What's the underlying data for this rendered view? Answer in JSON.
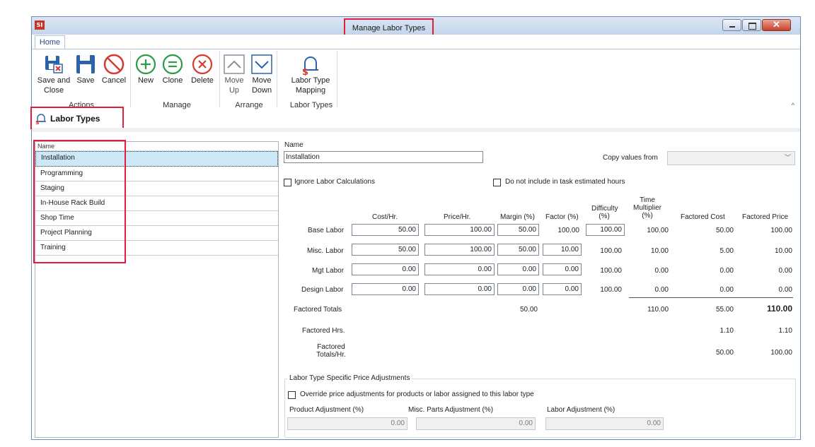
{
  "window": {
    "title": "Manage Labor Types",
    "app_icon": "SI"
  },
  "tabs": [
    {
      "label": "Home"
    }
  ],
  "ribbon": {
    "save_close": "Save and Close",
    "save_close_l1": "Save and",
    "save_close_l2": "Close",
    "save": "Save",
    "cancel": "Cancel",
    "new": "New",
    "clone": "Clone",
    "delete": "Delete",
    "move_up_l1": "Move",
    "move_up_l2": "Up",
    "move_down_l1": "Move",
    "move_down_l2": "Down",
    "mapping_l1": "Labor Type",
    "mapping_l2": "Mapping",
    "groups": {
      "actions": "Actions",
      "manage": "Manage",
      "arrange": "Arrange",
      "labor_types": "Labor Types"
    }
  },
  "header": {
    "title": "Labor Types"
  },
  "list": {
    "column": "Name",
    "items": [
      "Installation",
      "Programming",
      "Staging",
      "In-House Rack Build",
      "Shop Time",
      "Project Planning",
      "Training"
    ],
    "selected": "Installation"
  },
  "form": {
    "name_label": "Name",
    "name_value": "Installation",
    "copy_from_label": "Copy values from",
    "copy_from_value": "",
    "ignore_label": "Ignore Labor Calculations",
    "exclude_label": "Do not include in task estimated hours",
    "columns": {
      "cost": "Cost/Hr.",
      "price": "Price/Hr.",
      "margin": "Margin (%)",
      "factor": "Factor (%)",
      "difficulty_l1": "Difficulty",
      "difficulty_l2": "(%)",
      "time_l1": "Time",
      "time_l2": "Multiplier",
      "time_l3": "(%)",
      "factored_cost": "Factored Cost",
      "factored_price": "Factored Price"
    },
    "rows": [
      {
        "label": "Base Labor",
        "cost": "50.00",
        "price": "100.00",
        "margin": "50.00",
        "factor": "100.00",
        "difficulty": "100.00",
        "time": "100.00",
        "fcost": "50.00",
        "fprice": "100.00"
      },
      {
        "label": "Misc. Labor",
        "cost": "50.00",
        "price": "100.00",
        "margin": "50.00",
        "factor": "10.00",
        "difficulty": "100.00",
        "time": "10.00",
        "fcost": "5.00",
        "fprice": "10.00"
      },
      {
        "label": "Mgt Labor",
        "cost": "0.00",
        "price": "0.00",
        "margin": "0.00",
        "factor": "0.00",
        "difficulty": "100.00",
        "time": "0.00",
        "fcost": "0.00",
        "fprice": "0.00"
      },
      {
        "label": "Design Labor",
        "cost": "0.00",
        "price": "0.00",
        "margin": "0.00",
        "factor": "0.00",
        "difficulty": "100.00",
        "time": "0.00",
        "fcost": "0.00",
        "fprice": "0.00"
      }
    ],
    "totals": {
      "label": "Factored Totals",
      "margin": "50.00",
      "time": "110.00",
      "fcost": "55.00",
      "fprice": "110.00"
    },
    "hours": {
      "label": "Factored Hrs.",
      "fcost": "1.10",
      "fprice": "1.10"
    },
    "per_hour": {
      "label_l1": "Factored",
      "label_l2": "Totals/Hr.",
      "fcost": "50.00",
      "fprice": "100.00"
    },
    "adjustments": {
      "group_label": "Labor Type Specific Price Adjustments",
      "override_label": "Override price adjustments for products or labor assigned to this labor type",
      "product_label": "Product Adjustment (%)",
      "product_value": "0.00",
      "misc_label": "Misc. Parts Adjustment (%)",
      "misc_value": "0.00",
      "labor_label": "Labor Adjustment (%)",
      "labor_value": "0.00"
    }
  },
  "colors": {
    "highlight": "#e31d3c",
    "selection": "#cde8f7",
    "icon_blue": "#2a63a8",
    "icon_green": "#2f9a49",
    "icon_red": "#d93a30"
  }
}
